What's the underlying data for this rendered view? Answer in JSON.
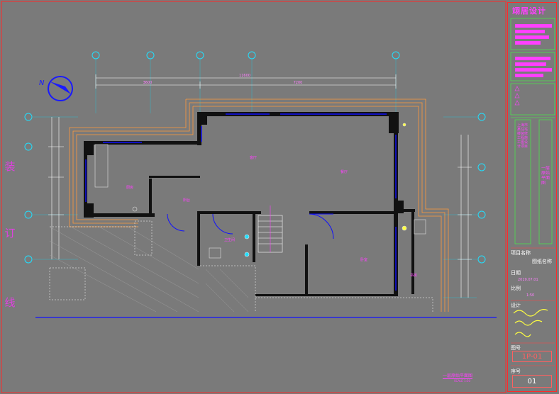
{
  "binding_margin": [
    "装",
    "订",
    "线"
  ],
  "grid_bubbles": {
    "top_count": 5,
    "left_count": 4,
    "right_count": 4
  },
  "dimensions": {
    "overall": "11600",
    "seg_a": "3600",
    "seg_b": "7200"
  },
  "rooms": {
    "living": "客厅",
    "bedroom": "卧室",
    "kitchen": "厨房",
    "dining": "餐厅",
    "bath": "卫生间",
    "balcony": "阳台",
    "study": "书房"
  },
  "title_block": {
    "company": "翊居设计",
    "project_label": "项目名称",
    "drawing_name_label": "图纸名称",
    "date_label": "日期",
    "date_value": "2019.07.01",
    "scale_label": "比例",
    "scale_value": "1:50",
    "designer_label": "设计",
    "drawing_no_label": "图号",
    "drawing_no": "1P-01",
    "seq_label": "序号",
    "seq_no": "01",
    "vertical_project": "上海市某住宅楼装修工程施工图设计项目",
    "vertical_drawing": "一层原始平面图"
  },
  "plan_title": "一层原始平面图",
  "plan_scale": "SCALE 1:50",
  "colors": {
    "background": "#7a7a7a",
    "grid_cyan": "#20e0ff",
    "wall_black": "#111111",
    "window_blue": "#1010ff",
    "offset_orange": "#ff9a3c",
    "label_magenta": "#ff30ff",
    "frame_red": "#ff2a2a"
  }
}
